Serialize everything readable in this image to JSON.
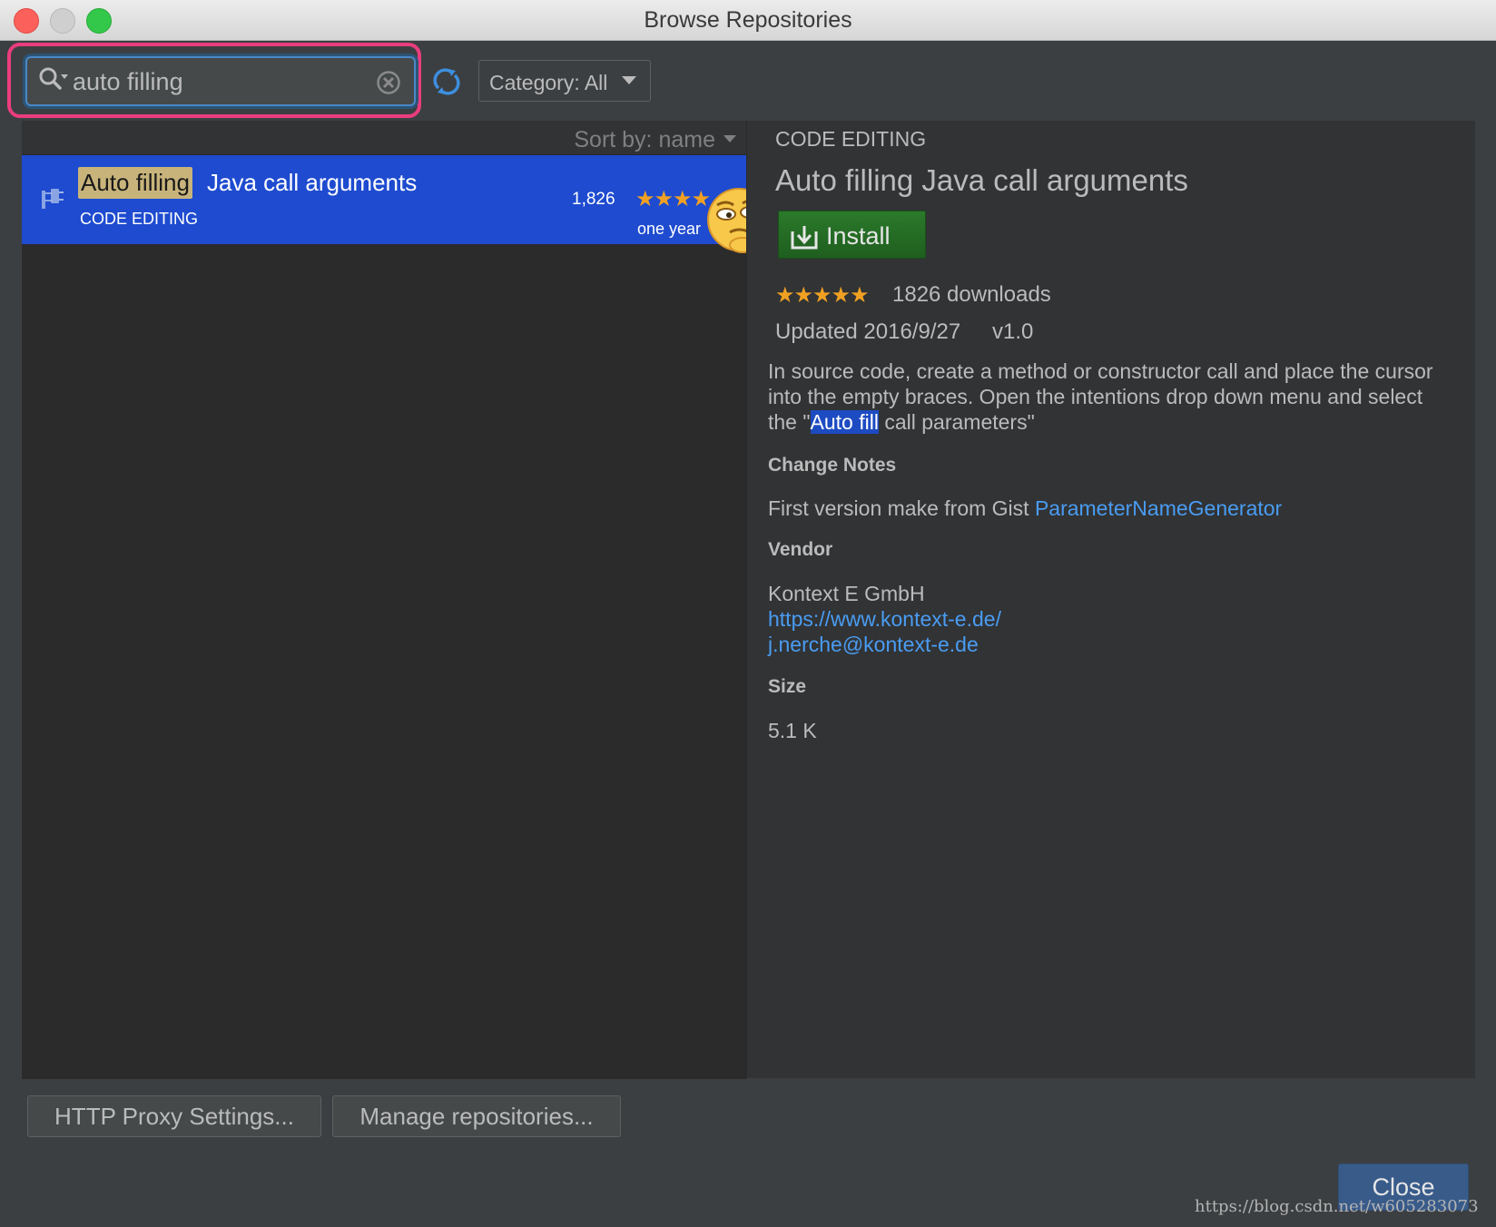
{
  "window": {
    "title": "Browse Repositories"
  },
  "toolbar": {
    "search_value": "auto filling",
    "category_label": "Category: All"
  },
  "list": {
    "sort_label": "Sort by: name",
    "items": [
      {
        "title_highlight": "Auto filling",
        "title_rest": "Java call arguments",
        "category": "CODE EDITING",
        "downloads": "1,826",
        "stars": "★★★★",
        "updated": "one year"
      }
    ]
  },
  "details": {
    "category": "CODE EDITING",
    "title": "Auto filling Java call arguments",
    "install_label": "Install",
    "stars": "★★★★★",
    "downloads": "1826 downloads",
    "updated": "Updated 2016/9/27",
    "version": "v1.0",
    "description_pre": "In source code, create a method or constructor call and place the cursor into the empty braces. Open the intentions drop down menu and select the \"",
    "description_highlight": "Auto fill",
    "description_post": " call parameters\"",
    "change_notes_heading": "Change Notes",
    "change_notes_text": "First version make from Gist ",
    "change_notes_link": "ParameterNameGenerator",
    "vendor_heading": "Vendor",
    "vendor_name": "Kontext E GmbH",
    "vendor_url": "https://www.kontext-e.de/",
    "vendor_email": "j.nerche@kontext-e.de",
    "size_heading": "Size",
    "size_value": "5.1 K"
  },
  "footer": {
    "proxy_button": "HTTP Proxy Settings...",
    "manage_button": "Manage repositories...",
    "close_button": "Close"
  },
  "watermark": "https://blog.csdn.net/w605283073",
  "colors": {
    "accent_selection": "#1e4bcf",
    "highlight_search": "#ea3d7e",
    "link": "#4a9cf2",
    "install_green": "#2b7a2b",
    "stars": "#f0a023"
  },
  "icons": [
    "search-icon",
    "clear-icon",
    "refresh-icon",
    "chevron-down-icon",
    "plugin-icon",
    "emoji-sticker",
    "download-icon"
  ]
}
